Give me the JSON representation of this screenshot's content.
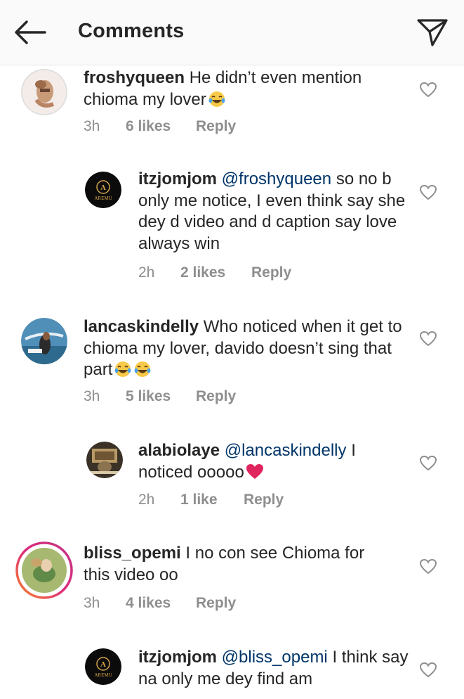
{
  "header": {
    "title": "Comments",
    "back_icon": "back-arrow-icon",
    "send_icon": "send-paper-plane-icon"
  },
  "comments": [
    {
      "username": "froshyqueen",
      "text": "He didn’t even mention chioma my lover",
      "emoji": "😂",
      "time": "3h",
      "likes": "6 likes",
      "reply": "Reply"
    },
    {
      "username": "itzjomjom",
      "mention": "@froshyqueen",
      "text": "so no b only me notice, I even think say she dey d video and d caption say love always win",
      "avatar_text": "AREMU",
      "time": "2h",
      "likes": "2 likes",
      "reply": "Reply"
    },
    {
      "username": "lancaskindelly",
      "text": "Who noticed when it get to chioma my lover, davido doesn’t sing that part",
      "emoji": "😂😂",
      "time": "3h",
      "likes": "5 likes",
      "reply": "Reply"
    },
    {
      "username": "alabiolaye",
      "mention": "@lancaskindelly",
      "text": "I noticed ooooo",
      "emoji": "❤️",
      "time": "2h",
      "likes": "1 like",
      "reply": "Reply"
    },
    {
      "username": "bliss_opemi",
      "text": "I no con see Chioma for this video oo",
      "time": "3h",
      "likes": "4 likes",
      "reply": "Reply"
    },
    {
      "username": "itzjomjom",
      "mention": "@bliss_opemi",
      "text": "I think say na only me dey find am",
      "avatar_text": "AREMU"
    }
  ],
  "colors": {
    "header_bg": "#fafafa",
    "text": "#262626",
    "mention": "#003569",
    "meta": "#8e8e8e",
    "heart_outline": "#8e8e8e",
    "heart_emoji": "#e0245e",
    "story_ring_start": "#f58529",
    "story_ring_end": "#dd2a7b"
  }
}
